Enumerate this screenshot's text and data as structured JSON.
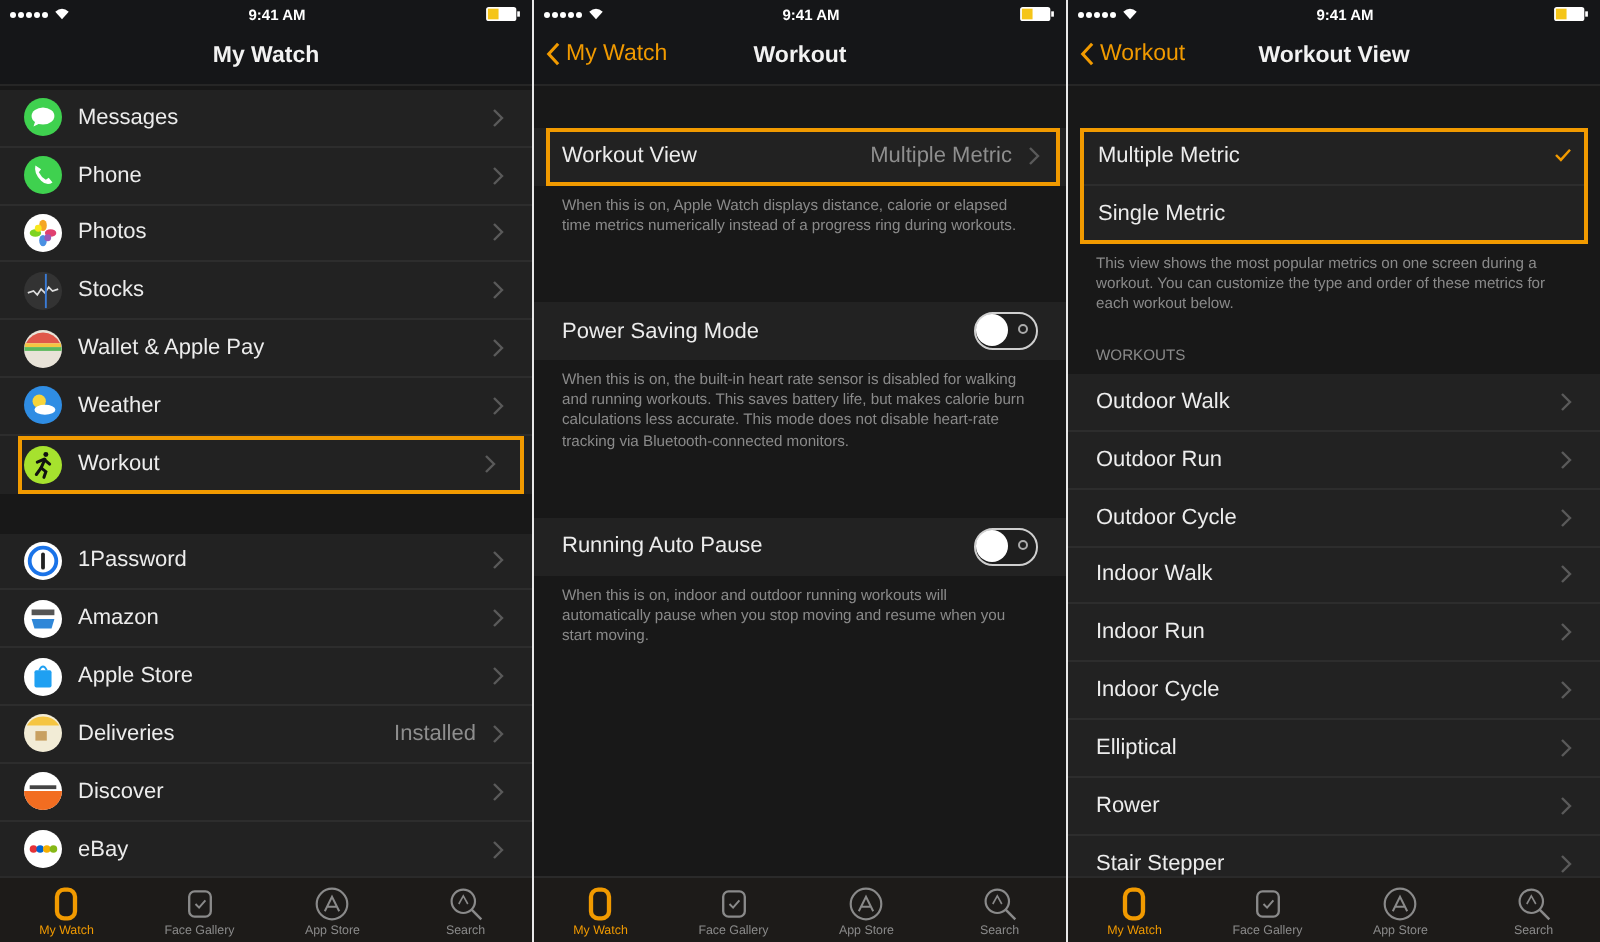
{
  "screens": [
    {
      "kind": "app_list",
      "status_bar": {
        "time": "9:41 AM"
      },
      "nav": {
        "title": "My Watch"
      },
      "sections": [
        {
          "rows": [
            {
              "label": "Messages",
              "highlighted": false
            },
            {
              "label": "Phone",
              "highlighted": false
            },
            {
              "label": "Photos",
              "highlighted": false
            },
            {
              "label": "Stocks",
              "highlighted": false
            },
            {
              "label": "Wallet & Apple Pay",
              "highlighted": false
            },
            {
              "label": "Weather",
              "highlighted": false
            },
            {
              "label": "Workout",
              "highlighted": true
            }
          ]
        },
        {
          "rows": [
            {
              "label": "1Password",
              "highlighted": false
            },
            {
              "label": "Amazon",
              "highlighted": false
            },
            {
              "label": "Apple Store",
              "highlighted": false
            },
            {
              "label": "Deliveries",
              "value": "Installed",
              "highlighted": false
            },
            {
              "label": "Discover",
              "highlighted": false
            },
            {
              "label": "eBay",
              "highlighted": false
            }
          ]
        }
      ],
      "tab_bar": [
        {
          "label": "My Watch",
          "selected": true
        },
        {
          "label": "Face Gallery",
          "selected": false
        },
        {
          "label": "App Store",
          "selected": false
        },
        {
          "label": "Search",
          "selected": false
        }
      ]
    },
    {
      "kind": "settings",
      "status_bar": {
        "time": "9:41 AM"
      },
      "nav": {
        "back": "My Watch",
        "title": "Workout"
      },
      "groups": [
        {
          "row": {
            "kind": "disclosure",
            "label": "Workout View",
            "value": "Multiple Metric",
            "highlighted": true
          },
          "footer": "When this is on, Apple Watch displays distance, calorie or elapsed time metrics numerically instead of a progress ring during workouts."
        },
        {
          "row": {
            "kind": "switch",
            "label": "Power Saving Mode",
            "on": false,
            "highlighted": false
          },
          "footer": "When this is on, the built-in heart rate sensor is disabled for walking and running workouts. This saves battery life, but makes calorie burn calculations less accurate. This mode does not disable heart-rate tracking via Bluetooth-connected monitors."
        },
        {
          "row": {
            "kind": "switch",
            "label": "Running Auto Pause",
            "on": false,
            "highlighted": false
          },
          "footer": "When this is on, indoor and outdoor running workouts will automatically pause when you stop moving and resume when you start moving."
        }
      ],
      "tab_bar": [
        {
          "label": "My Watch",
          "selected": true
        },
        {
          "label": "Face Gallery",
          "selected": false
        },
        {
          "label": "App Store",
          "selected": false
        },
        {
          "label": "Search",
          "selected": false
        }
      ]
    },
    {
      "kind": "options",
      "status_bar": {
        "time": "9:41 AM"
      },
      "nav": {
        "back": "Workout",
        "title": "Workout View"
      },
      "options": {
        "highlighted": true,
        "items": [
          {
            "label": "Multiple Metric",
            "selected": true
          },
          {
            "label": "Single Metric",
            "selected": false
          }
        ],
        "footer": "This view shows the most popular metrics on one screen during a workout. You can customize the type and order of these metrics for each workout below."
      },
      "workouts": {
        "header": "WORKOUTS",
        "rows": [
          {
            "label": "Outdoor Walk"
          },
          {
            "label": "Outdoor Run"
          },
          {
            "label": "Outdoor Cycle"
          },
          {
            "label": "Indoor Walk"
          },
          {
            "label": "Indoor Run"
          },
          {
            "label": "Indoor Cycle"
          },
          {
            "label": "Elliptical"
          },
          {
            "label": "Rower"
          },
          {
            "label": "Stair Stepper"
          }
        ]
      },
      "tab_bar": [
        {
          "label": "My Watch",
          "selected": true
        },
        {
          "label": "Face Gallery",
          "selected": false
        },
        {
          "label": "App Store",
          "selected": false
        },
        {
          "label": "Search",
          "selected": false
        }
      ]
    }
  ]
}
